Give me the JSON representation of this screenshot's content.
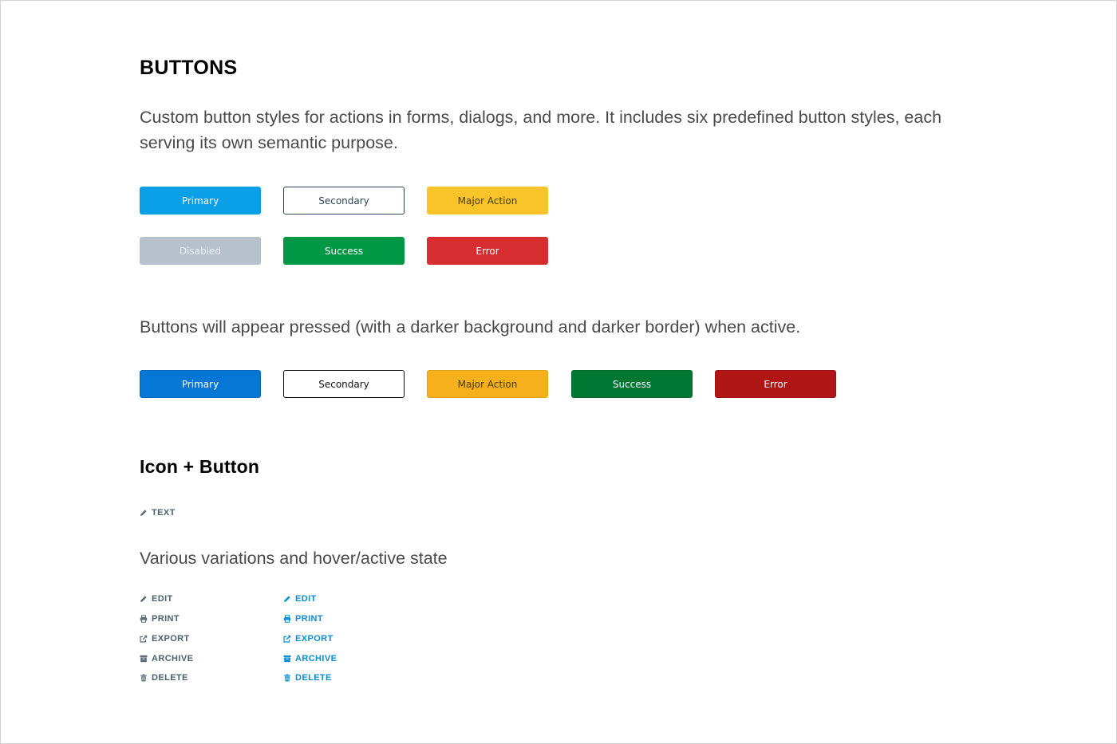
{
  "title": "BUTTONS",
  "intro": "Custom button styles for actions in forms, dialogs, and more. It includes six predefined button styles, each serving its own semantic purpose.",
  "buttons": {
    "primary": "Primary",
    "secondary": "Secondary",
    "major": "Major Action",
    "disabled": "Disabled",
    "success": "Success",
    "error": "Error"
  },
  "pressed_text": "Buttons will appear pressed (with a darker background and darker border) when active.",
  "pressed_buttons": {
    "primary": "Primary",
    "secondary": "Secondary",
    "major": "Major Action",
    "success": "Success",
    "error": "Error"
  },
  "icon_section": {
    "heading": "Icon + Button",
    "example_label": "TEXT",
    "variations_text": "Various variations and hover/active state",
    "default_column": [
      {
        "label": "EDIT",
        "icon": "pencil-icon"
      },
      {
        "label": "PRINT",
        "icon": "print-icon"
      },
      {
        "label": "EXPORT",
        "icon": "export-icon"
      },
      {
        "label": "ARCHIVE",
        "icon": "archive-icon"
      },
      {
        "label": "DELETE",
        "icon": "trash-icon"
      }
    ],
    "active_column": [
      {
        "label": "EDIT",
        "icon": "pencil-icon"
      },
      {
        "label": "PRINT",
        "icon": "print-icon"
      },
      {
        "label": "EXPORT",
        "icon": "export-icon"
      },
      {
        "label": "ARCHIVE",
        "icon": "archive-icon"
      },
      {
        "label": "DELETE",
        "icon": "trash-icon"
      }
    ]
  },
  "colors": {
    "primary": "#0a9ee6",
    "primary_active": "#0777d6",
    "secondary_border": "#2d4556",
    "major": "#f8c42a",
    "major_active": "#f5b01b",
    "disabled": "#b6c1cc",
    "success": "#009845",
    "success_active": "#007733",
    "error": "#d62d30",
    "error_active": "#b01516",
    "icon_link_default": "#4b6071",
    "icon_link_active": "#078fd3"
  }
}
